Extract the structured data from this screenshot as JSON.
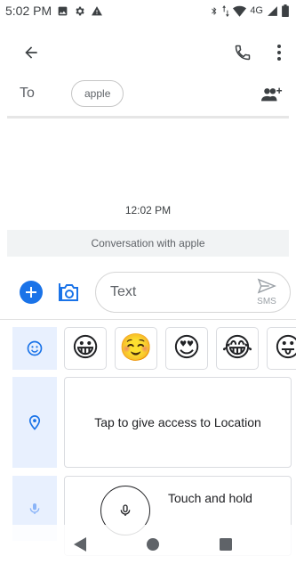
{
  "status_bar": {
    "time": "5:02 PM",
    "network": "4G",
    "icons_left": [
      "image-icon",
      "gear-icon",
      "warning-icon"
    ],
    "icons_right": [
      "bluetooth-icon",
      "data-arrows-icon",
      "wifi-icon",
      "signal-icon",
      "battery-icon"
    ]
  },
  "top_bar": {
    "back_icon": "arrow-left-icon",
    "call_icon": "phone-icon",
    "more_icon": "more-vert-icon"
  },
  "recipients": {
    "to_label": "To",
    "chips": [
      "apple"
    ],
    "add_people_icon": "add-people-icon"
  },
  "conversation": {
    "timestamp": "12:02 PM",
    "banner": "Conversation with apple"
  },
  "compose": {
    "placeholder": "Text",
    "value": "",
    "send_label": "SMS",
    "attach_icon": "plus-circle-icon",
    "camera_icon": "camera-icon",
    "send_icon": "send-icon"
  },
  "panel": {
    "tabs": [
      "smiley-icon",
      "location-pin-icon",
      "mic-icon"
    ],
    "emojis": [
      "😀",
      "☺️",
      "😍",
      "😂",
      "😛"
    ],
    "location_prompt": "Tap to give access to Location",
    "audio_prompt": "Touch and hold"
  },
  "nav_bar": {
    "buttons": [
      "back-triangle-icon",
      "home-circle-icon",
      "recents-square-icon"
    ]
  },
  "colors": {
    "accent": "#1a73e8",
    "tab_background": "#e8f0fe",
    "banner_background": "#f1f3f4"
  }
}
